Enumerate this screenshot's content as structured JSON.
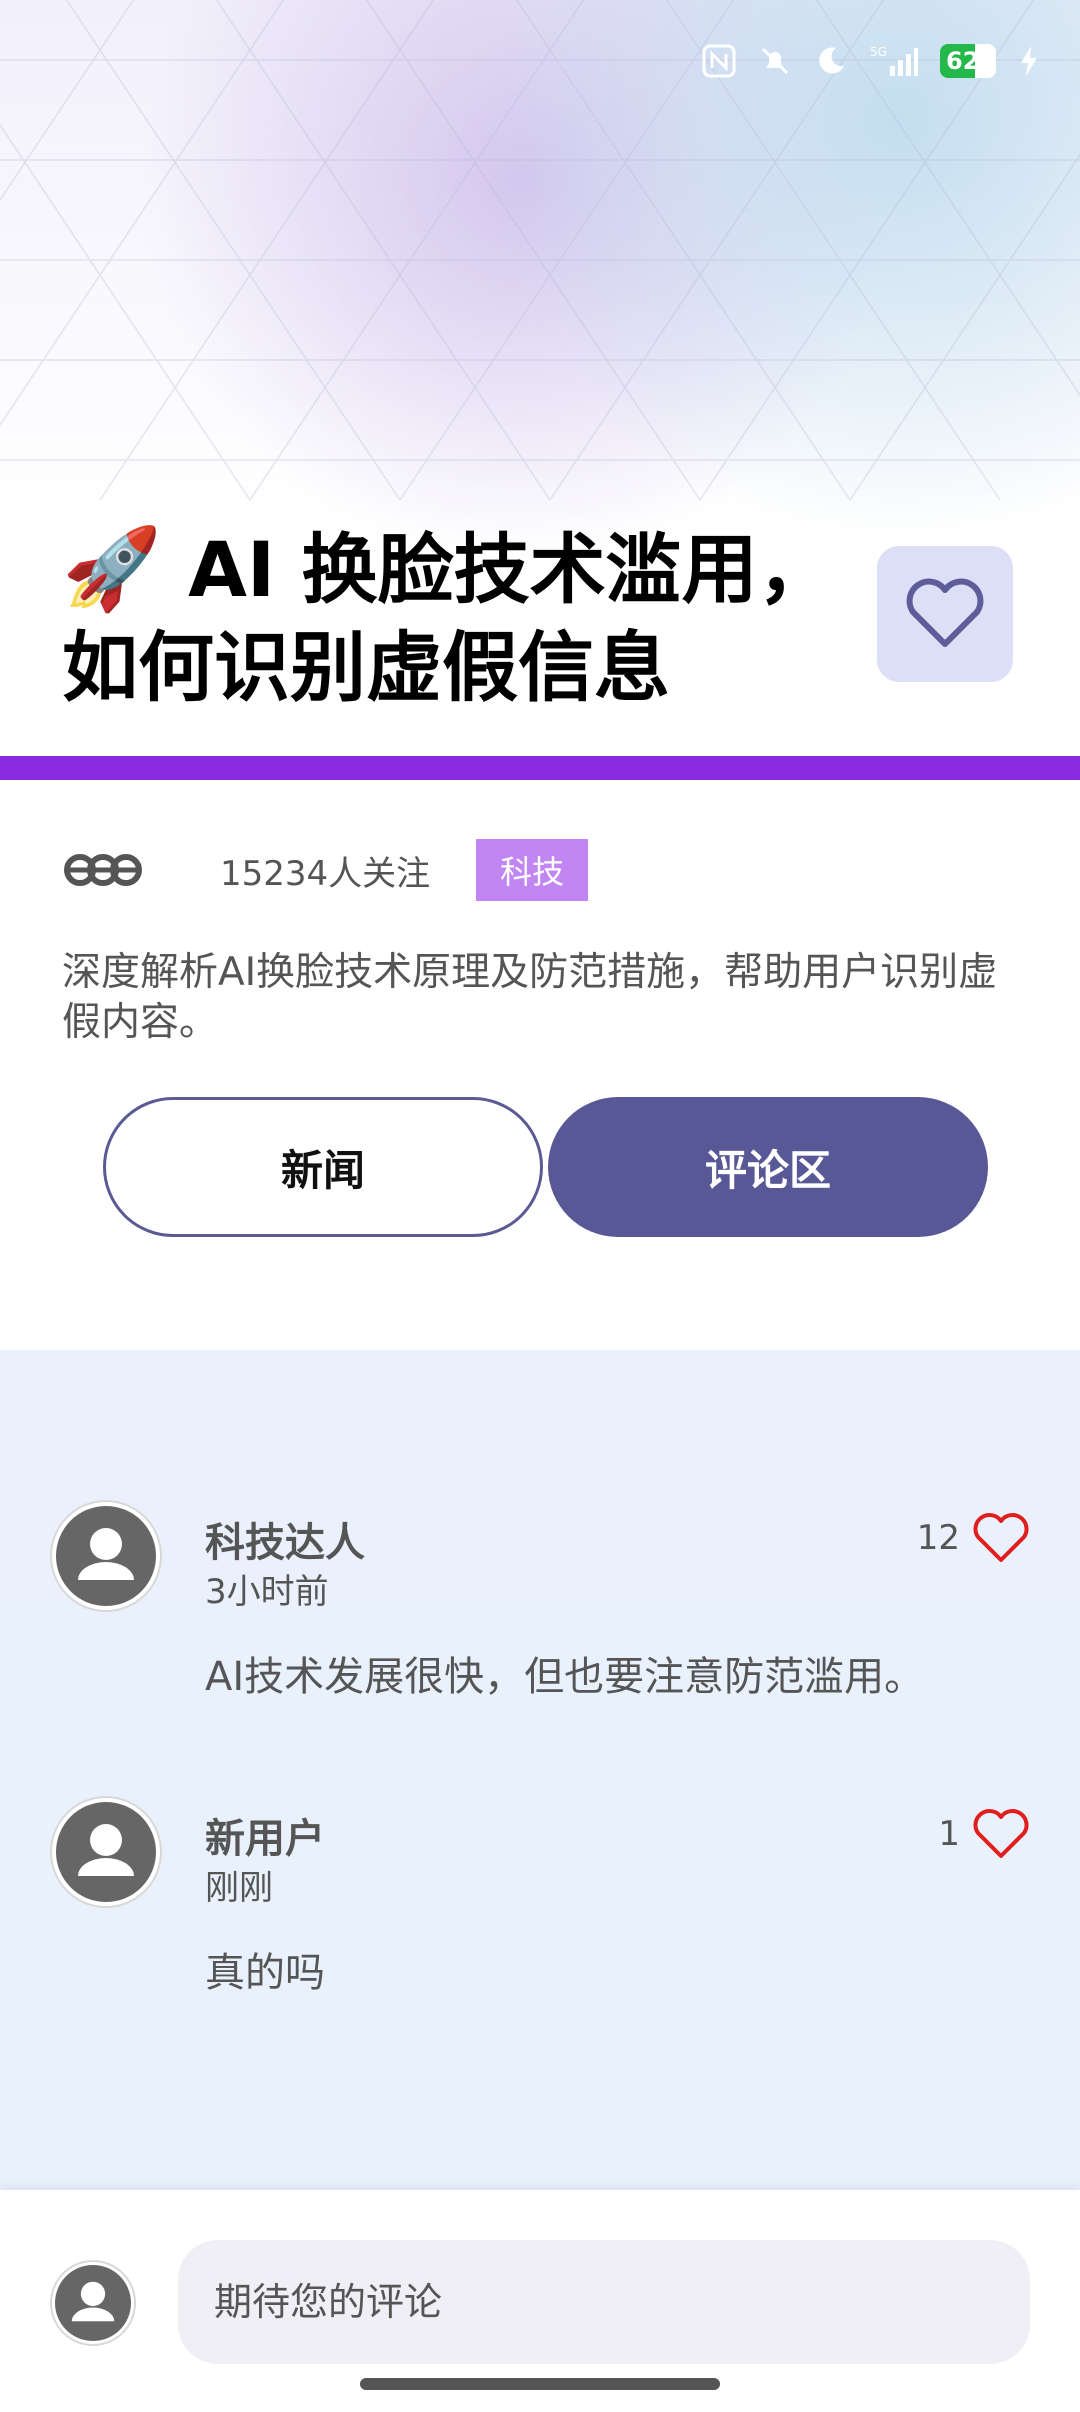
{
  "status_bar": {
    "battery_level": "62",
    "icons": [
      "nfc-icon",
      "mute-bell-icon",
      "moon-icon",
      "signal-5g-icon",
      "battery-icon",
      "charging-icon"
    ]
  },
  "header": {
    "emoji": "🚀",
    "title": "AI 换脸技术滥用，如何识别虚假信息",
    "accent_color": "#8a2be2"
  },
  "meta": {
    "followers": "15234人关注",
    "tag": "科技"
  },
  "description": "深度解析AI换脸技术原理及防范措施，帮助用户识别虚假内容。",
  "tabs": [
    {
      "label": "新闻",
      "active": false
    },
    {
      "label": "评论区",
      "active": true
    }
  ],
  "comments": [
    {
      "name": "科技达人",
      "time": "3小时前",
      "text": "AI技术发展很快，但也要注意防范滥用。",
      "likes": "12"
    },
    {
      "name": "新用户",
      "time": "刚刚",
      "text": "真的吗",
      "likes": "1"
    }
  ],
  "composer": {
    "placeholder": "期待您的评论"
  }
}
